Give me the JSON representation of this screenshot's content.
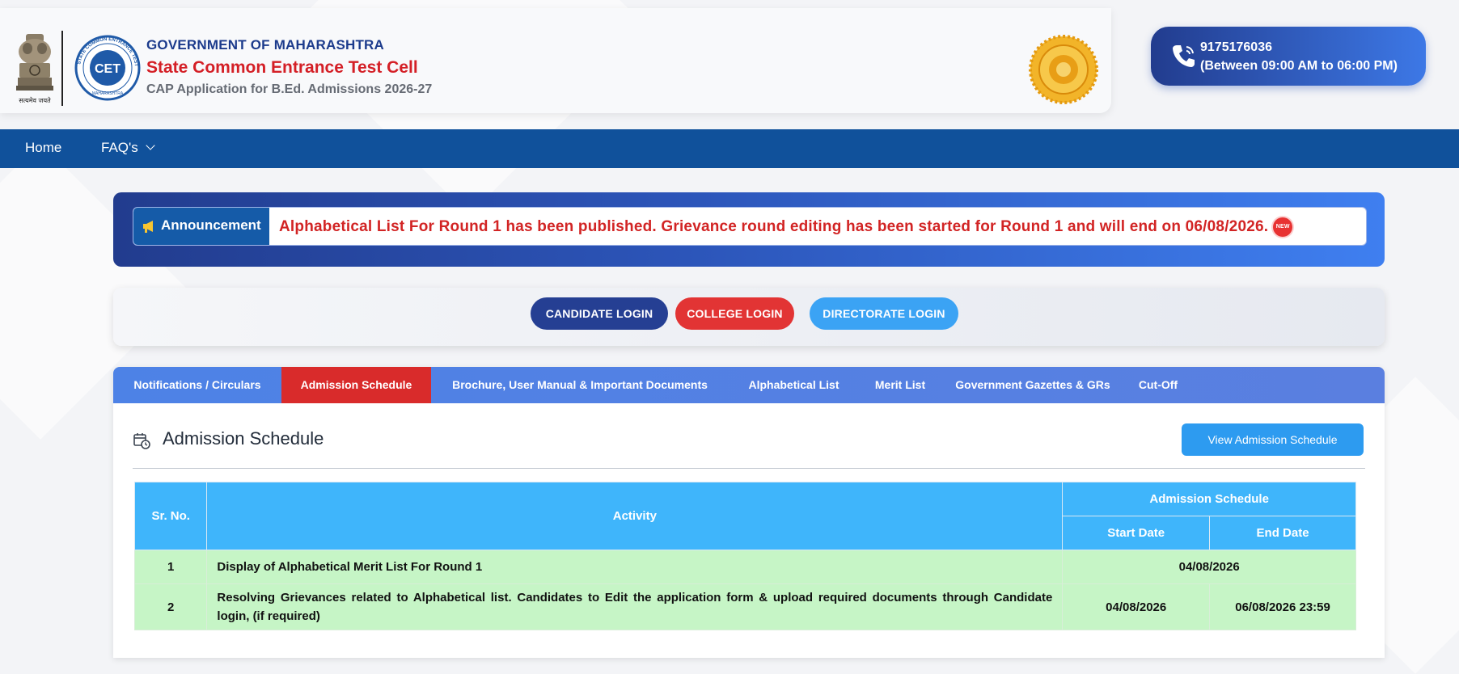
{
  "header": {
    "emblem_caption": "सत्यमेव जयते",
    "government": "GOVERNMENT OF MAHARASHTRA",
    "org_name": "State Common Entrance Test Cell",
    "application_title": "CAP Application for B.Ed. Admissions 2026-27",
    "logo_text": "CET",
    "logo_ring_text": "STATE COMMON ENTRANCE TEST CELL",
    "logo_bottom_text": "MAHARASHTRA",
    "helpline_number": "9175176036",
    "helpline_hours": "(Between 09:00 AM to 06:00 PM)"
  },
  "nav": {
    "items": [
      {
        "label": "Home"
      },
      {
        "label": "FAQ's"
      }
    ]
  },
  "announcement": {
    "label": "Announcement",
    "text": "Alphabetical List For Round 1 has been published. Grievance round editing has been started for Round 1 and will end on 06/08/2026.",
    "badge": "NEW"
  },
  "login": {
    "candidate": "CANDIDATE LOGIN",
    "college": "COLLEGE LOGIN",
    "directorate": "DIRECTORATE LOGIN"
  },
  "tabs": [
    {
      "label": "Notifications / Circulars"
    },
    {
      "label": "Admission Schedule",
      "active": true
    },
    {
      "label": "Brochure, User Manual & Important Documents"
    },
    {
      "label": "Alphabetical List"
    },
    {
      "label": "Merit List"
    },
    {
      "label": "Government Gazettes & GRs"
    },
    {
      "label": "Cut-Off"
    }
  ],
  "section": {
    "title": "Admission Schedule",
    "view_button": "View Admission Schedule"
  },
  "table": {
    "headers": {
      "sr_no": "Sr. No.",
      "activity": "Activity",
      "schedule": "Admission Schedule",
      "start": "Start Date",
      "end": "End Date"
    },
    "rows": [
      {
        "sr": "1",
        "activity": "Display of Alphabetical Merit List For Round 1",
        "date": "04/08/2026"
      },
      {
        "sr": "2",
        "activity": "Resolving Grievances related to Alphabetical list. Candidates to Edit the application form & upload required documents through Candidate login, (if required)",
        "start": "04/08/2026",
        "end": "06/08/2026 23:59"
      }
    ]
  },
  "colors": {
    "nav_bg": "#10519b",
    "brand_red": "#d41f26",
    "brand_blue": "#1c3b8c",
    "active_tab": "#d92b2b",
    "table_header": "#3fb5fb",
    "table_row": "#c6f5c6"
  }
}
